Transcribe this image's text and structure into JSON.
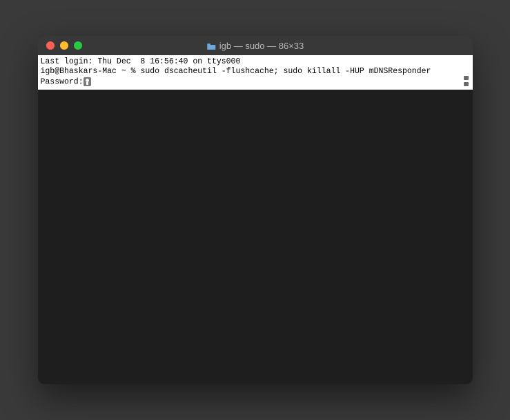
{
  "titlebar": {
    "title": "igb — sudo — 86×33"
  },
  "terminal": {
    "line1": "Last login: Thu Dec  8 16:56:40 on ttys000",
    "line2_prompt": "igb@Bhaskars-Mac ~ % ",
    "line2_command": "sudo dscacheutil -flushcache; sudo killall -HUP mDNSResponder",
    "line3": "Password:"
  }
}
